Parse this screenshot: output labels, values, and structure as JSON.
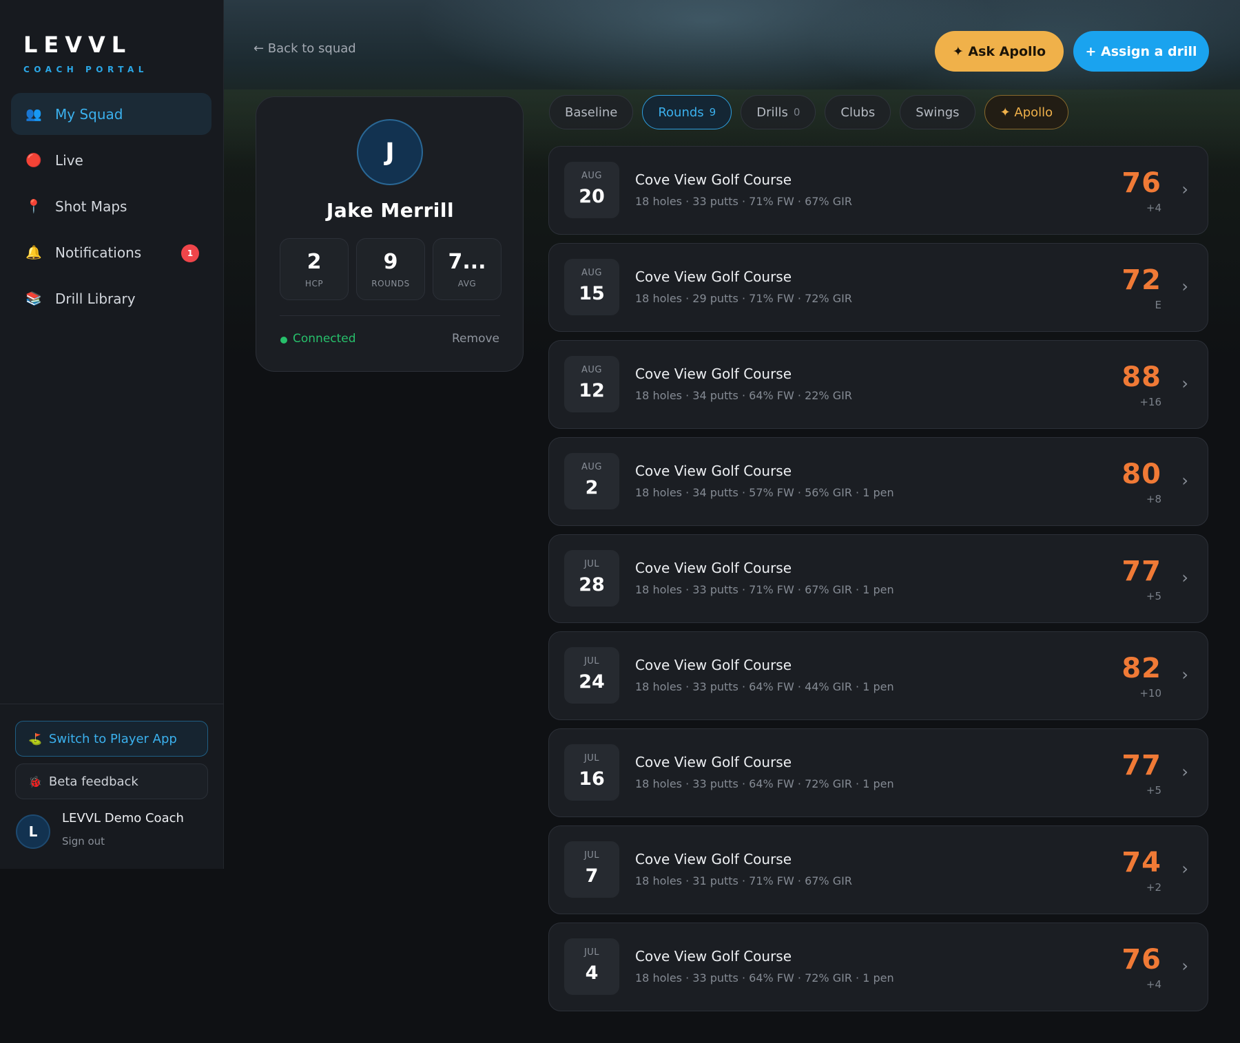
{
  "brand": {
    "logo": "LEVVL",
    "subtitle": "COACH PORTAL"
  },
  "sidebar": {
    "items": [
      {
        "label": "My Squad",
        "icon": "👥",
        "active": true
      },
      {
        "label": "Live",
        "icon": "🔴"
      },
      {
        "label": "Shot Maps",
        "icon": "📍"
      },
      {
        "label": "Notifications",
        "icon": "🔔",
        "badge": "1"
      },
      {
        "label": "Drill Library",
        "icon": "📚"
      }
    ],
    "switch_label": "Switch to Player App",
    "switch_icon": "⛳",
    "beta_label": "Beta feedback",
    "beta_icon": "🐞",
    "user": {
      "initial": "L",
      "name": "LEVVL Demo Coach",
      "signout": "Sign out"
    }
  },
  "header": {
    "back": "← Back to squad",
    "ask_apollo": "✦ Ask Apollo",
    "assign_drill": "+ Assign a drill"
  },
  "player": {
    "initial": "J",
    "name": "Jake Merrill",
    "stats": [
      {
        "value": "2",
        "label": "HCP"
      },
      {
        "value": "9",
        "label": "ROUNDS"
      },
      {
        "value": "7...",
        "label": "AVG"
      }
    ],
    "status": "Connected",
    "remove": "Remove"
  },
  "tabs": [
    {
      "label": "Baseline"
    },
    {
      "label": "Rounds",
      "count": "9",
      "active": true
    },
    {
      "label": "Drills",
      "count": "0"
    },
    {
      "label": "Clubs"
    },
    {
      "label": "Swings"
    },
    {
      "label": "✦ Apollo"
    }
  ],
  "rounds": [
    {
      "month": "AUG",
      "day": "20",
      "course": "Cove View Golf Course",
      "details": "18 holes · 33 putts · 71% FW · 67% GIR",
      "score": "76",
      "par": "+4"
    },
    {
      "month": "AUG",
      "day": "15",
      "course": "Cove View Golf Course",
      "details": "18 holes · 29 putts · 71% FW · 72% GIR",
      "score": "72",
      "par": "E"
    },
    {
      "month": "AUG",
      "day": "12",
      "course": "Cove View Golf Course",
      "details": "18 holes · 34 putts · 64% FW · 22% GIR",
      "score": "88",
      "par": "+16"
    },
    {
      "month": "AUG",
      "day": "2",
      "course": "Cove View Golf Course",
      "details": "18 holes · 34 putts · 57% FW · 56% GIR · 1 pen",
      "score": "80",
      "par": "+8"
    },
    {
      "month": "JUL",
      "day": "28",
      "course": "Cove View Golf Course",
      "details": "18 holes · 33 putts · 71% FW · 67% GIR · 1 pen",
      "score": "77",
      "par": "+5"
    },
    {
      "month": "JUL",
      "day": "24",
      "course": "Cove View Golf Course",
      "details": "18 holes · 33 putts · 64% FW · 44% GIR · 1 pen",
      "score": "82",
      "par": "+10"
    },
    {
      "month": "JUL",
      "day": "16",
      "course": "Cove View Golf Course",
      "details": "18 holes · 33 putts · 64% FW · 72% GIR · 1 pen",
      "score": "77",
      "par": "+5"
    },
    {
      "month": "JUL",
      "day": "7",
      "course": "Cove View Golf Course",
      "details": "18 holes · 31 putts · 71% FW · 67% GIR",
      "score": "74",
      "par": "+2"
    },
    {
      "month": "JUL",
      "day": "4",
      "course": "Cove View Golf Course",
      "details": "18 holes · 33 putts · 64% FW · 72% GIR · 1 pen",
      "score": "76",
      "par": "+4"
    }
  ],
  "colors": {
    "accent": "#1aa3ef",
    "apollo": "#f0b14a",
    "score": "#f07a36",
    "connected": "#27c06b"
  }
}
